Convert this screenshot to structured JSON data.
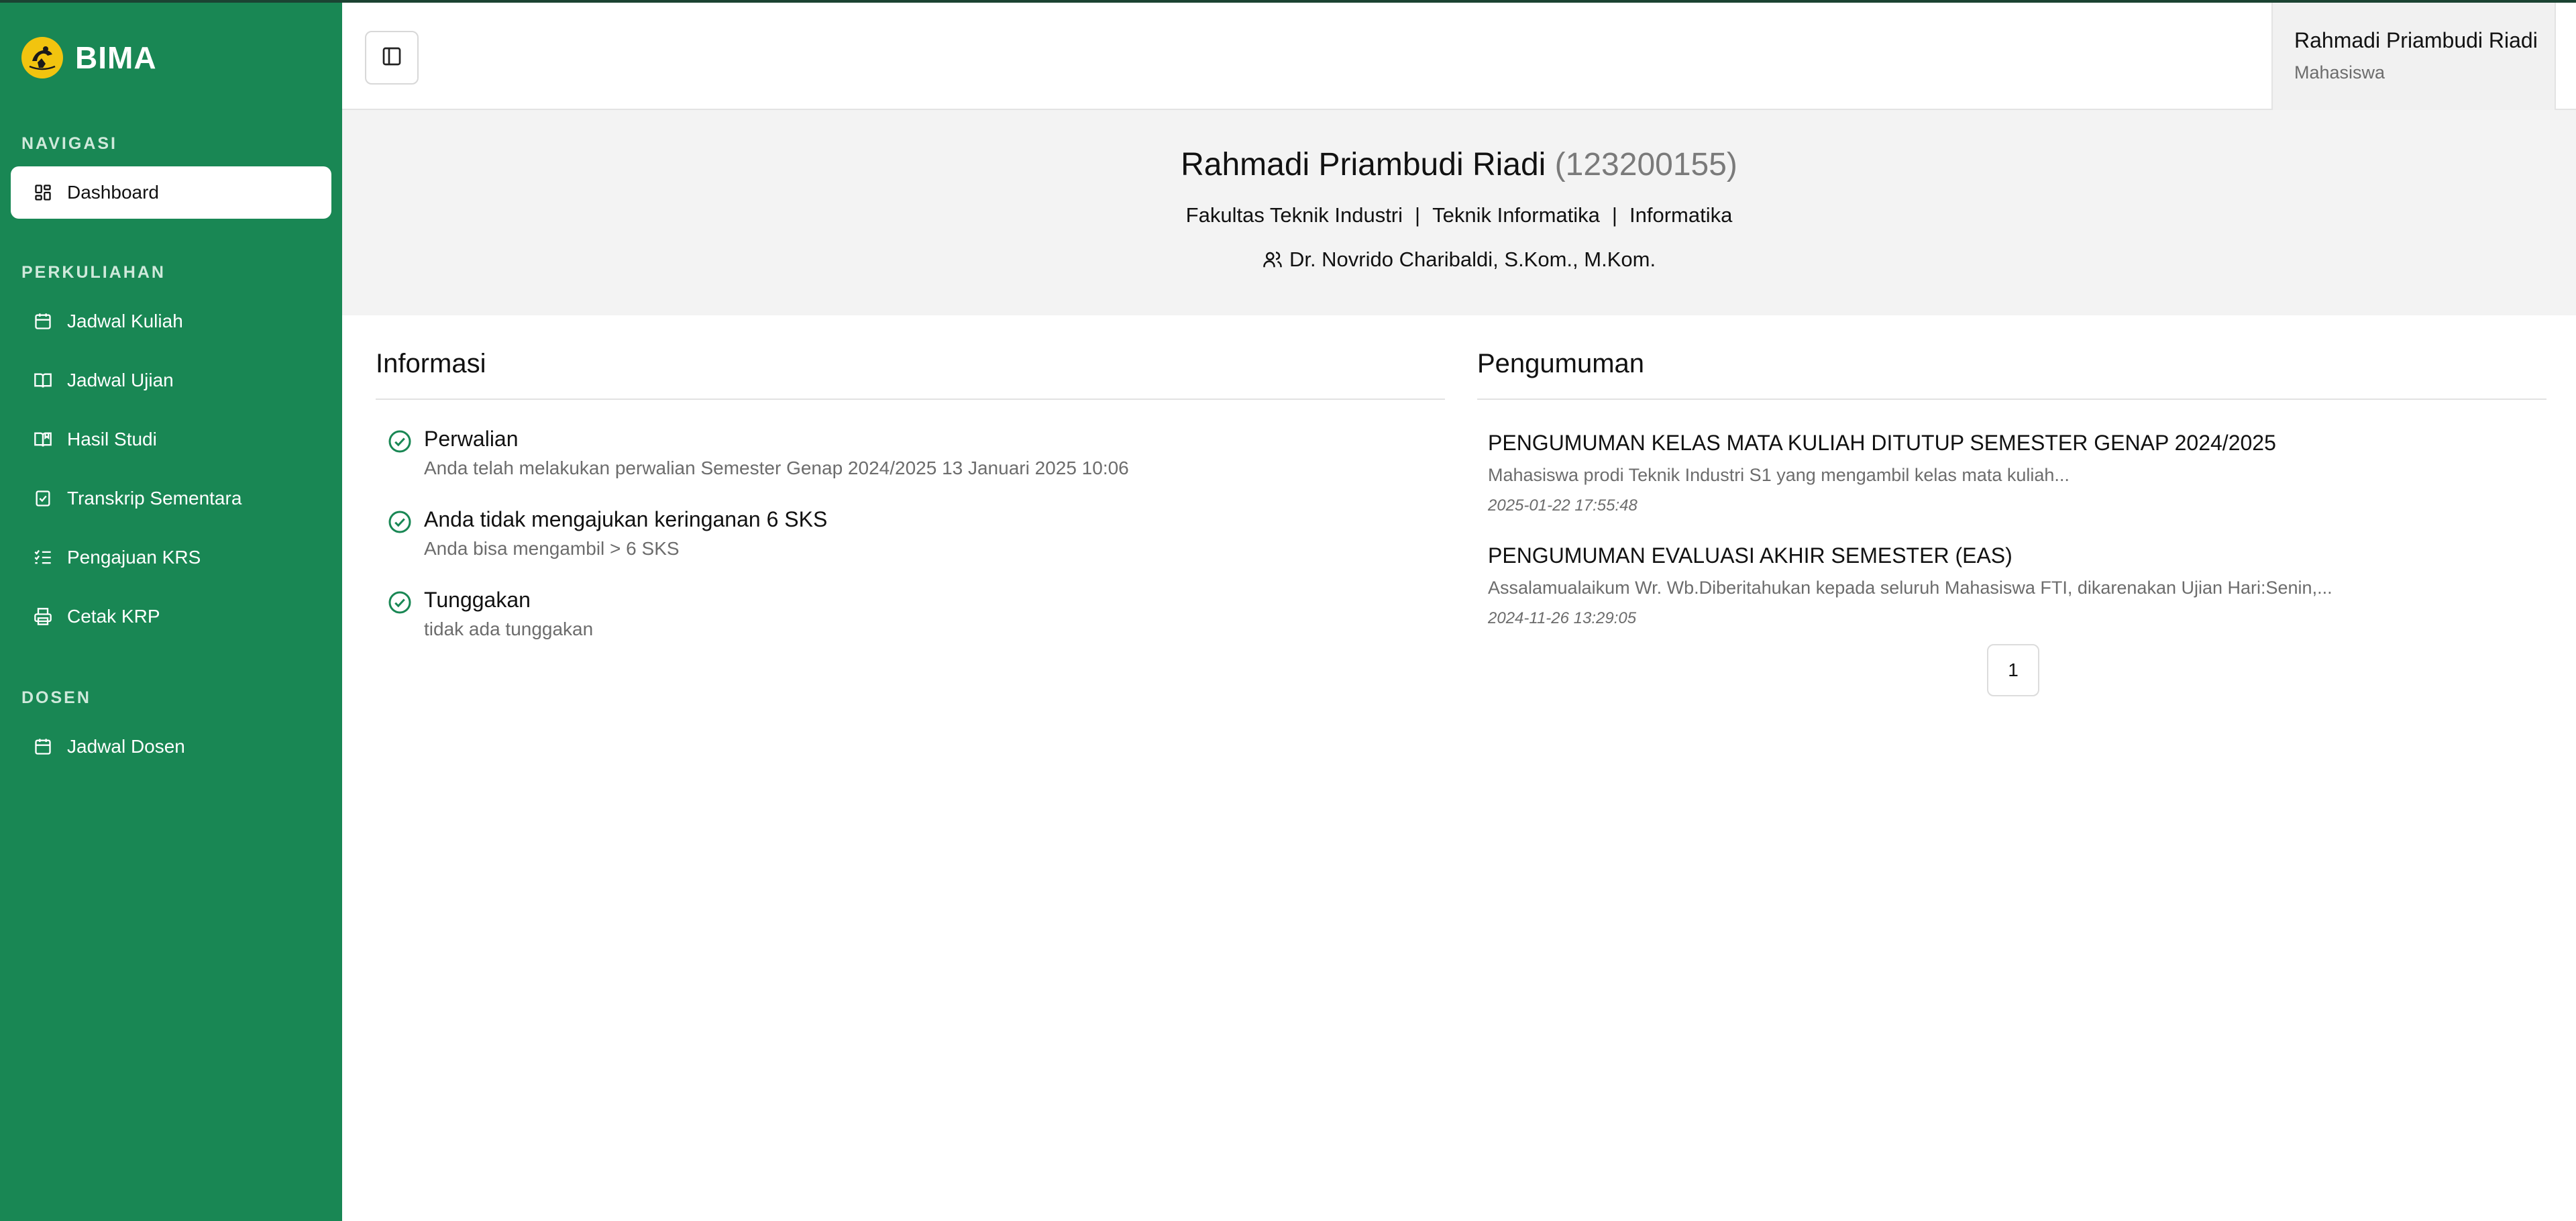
{
  "brand": {
    "name": "BIMA"
  },
  "sidebar": {
    "sections": [
      {
        "label": "NAVIGASI"
      },
      {
        "label": "PERKULIAHAN"
      },
      {
        "label": "DOSEN"
      }
    ],
    "items": [
      {
        "label": "Dashboard",
        "icon": "dashboard-icon",
        "active": true
      },
      {
        "label": "Jadwal Kuliah",
        "icon": "calendar-icon"
      },
      {
        "label": "Jadwal Ujian",
        "icon": "book-open-icon"
      },
      {
        "label": "Hasil Studi",
        "icon": "book-bookmark-icon"
      },
      {
        "label": "Transkrip Sementara",
        "icon": "clipboard-check-icon"
      },
      {
        "label": "Pengajuan KRS",
        "icon": "list-check-icon"
      },
      {
        "label": "Cetak KRP",
        "icon": "printer-icon"
      },
      {
        "label": "Jadwal Dosen",
        "icon": "calendar-icon"
      }
    ]
  },
  "header": {
    "toggle_icon": "sidebar-toggle-icon",
    "user": {
      "name": "Rahmadi Priambudi Riadi",
      "role": "Mahasiswa"
    }
  },
  "profile": {
    "name": "Rahmadi Priambudi Riadi",
    "nim": "(123200155)",
    "faculty": "Fakultas Teknik Industri",
    "department": "Teknik Informatika",
    "program": "Informatika",
    "separator": "|",
    "advisor": "Dr. Novrido Charibaldi, S.Kom., M.Kom."
  },
  "informasi": {
    "title": "Informasi",
    "items": [
      {
        "title": "Perwalian",
        "desc": "Anda telah melakukan perwalian Semester Genap 2024/2025 13 Januari 2025 10:06"
      },
      {
        "title": "Anda tidak mengajukan keringanan 6 SKS",
        "desc": "Anda bisa mengambil > 6 SKS"
      },
      {
        "title": "Tunggakan",
        "desc": "tidak ada tunggakan"
      }
    ]
  },
  "pengumuman": {
    "title": "Pengumuman",
    "items": [
      {
        "title": "PENGUMUMAN KELAS MATA KULIAH DITUTUP SEMESTER GENAP 2024/2025",
        "desc": "Mahasiswa prodi Teknik Industri S1 yang mengambil kelas mata kuliah...",
        "date": "2025-01-22 17:55:48"
      },
      {
        "title": "PENGUMUMAN EVALUASI AKHIR SEMESTER (EAS)",
        "desc": "Assalamualaikum Wr. Wb.Diberitahukan kepada seluruh Mahasiswa FTI, dikarenakan Ujian Hari:Senin,...",
        "date": "2024-11-26 13:29:05"
      }
    ],
    "page": "1"
  },
  "colors": {
    "sidebar": "#198754",
    "check": "#198754",
    "banner": "#f3f3f3"
  }
}
